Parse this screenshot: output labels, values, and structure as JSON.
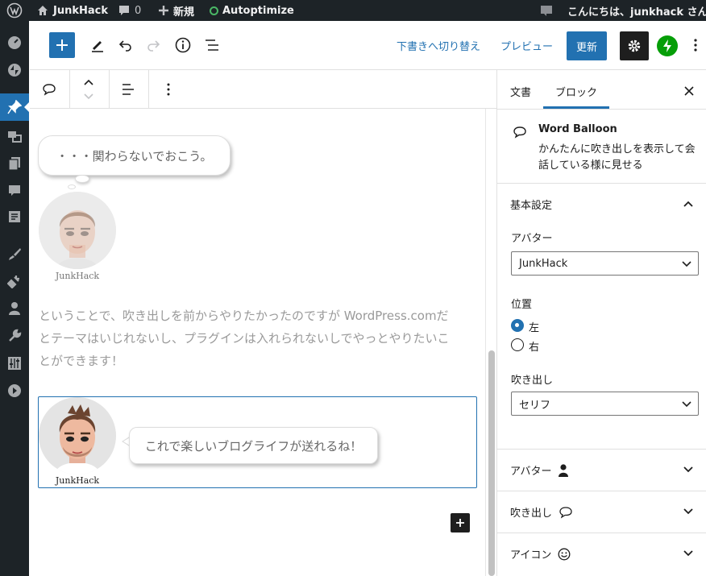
{
  "admin_bar": {
    "site_name": "JunkHack",
    "comments_count": "0",
    "new_label": "新規",
    "autoptimize_label": "Autoptimize",
    "greeting": "こんにちは、junkhack さん"
  },
  "toolbar": {
    "switch_draft_label": "下書きへ切り替え",
    "preview_label": "プレビュー",
    "update_label": "更新"
  },
  "sidebar": {
    "tabs": [
      "文書",
      "ブロック"
    ],
    "block_name": "Word Balloon",
    "block_description": "かんたんに吹き出しを表示して会話している様に見せる",
    "basic_settings_title": "基本設定",
    "avatar_label": "アバター",
    "avatar_value": "JunkHack",
    "position_label": "位置",
    "position_options": [
      "左",
      "右"
    ],
    "position_selected": "左",
    "balloon_label": "吹き出し",
    "balloon_value": "セリフ",
    "panels": [
      {
        "label": "アバター",
        "icon": "user-icon"
      },
      {
        "label": "吹き出し",
        "icon": "speech-bubble-icon"
      },
      {
        "label": "アイコン",
        "icon": "smiley-icon"
      }
    ]
  },
  "content": {
    "balloon1_text": "・・・関わらないでおこう。",
    "avatar1_name": "JunkHack",
    "paragraph_lines": [
      "ということで、吹き出しを前からやりたかったのですが WordPress.comだ",
      "とテーマはいじれないし、プラグインは入れられないしでやっとやりたいこ",
      "とができます！"
    ],
    "avatar2_name": "JunkHack",
    "balloon2_text": "これで楽しいブログライフが送れるね！"
  },
  "colors": {
    "accent": "#2271b1",
    "admin_bg": "#1d2327",
    "jetpack": "#069e08"
  }
}
